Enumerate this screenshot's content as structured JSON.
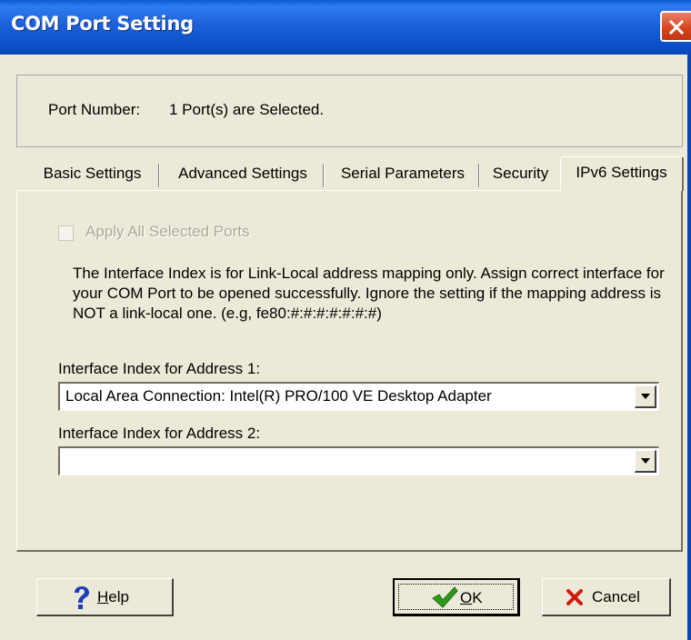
{
  "window": {
    "title": "COM Port Setting"
  },
  "port": {
    "label": "Port Number:",
    "value": "1 Port(s) are Selected."
  },
  "tabs": [
    {
      "label": "Basic Settings"
    },
    {
      "label": "Advanced Settings"
    },
    {
      "label": "Serial Parameters"
    },
    {
      "label": "Security"
    },
    {
      "label": "IPv6 Settings",
      "active": true
    }
  ],
  "apply_all": {
    "label": "Apply All Selected Ports",
    "checked": false,
    "enabled": false
  },
  "description": "The Interface Index is for Link-Local address mapping only. Assign correct interface for your COM Port to be opened successfully. Ignore the setting if the mapping address is NOT a link-local one. (e.g, fe80:#:#:#:#:#:#:#)",
  "address1": {
    "label": "Interface Index for Address 1:",
    "value": "Local Area Connection: Intel(R) PRO/100 VE Desktop Adapter"
  },
  "address2": {
    "label": "Interface Index for Address 2:",
    "value": ""
  },
  "buttons": {
    "help": {
      "mnemonic": "H",
      "rest": "elp"
    },
    "ok": {
      "mnemonic": "O",
      "rest": "K"
    },
    "cancel": {
      "label": "Cancel"
    }
  },
  "icons": {
    "help": "question-mark-icon",
    "ok": "checkmark-icon",
    "cancel": "red-x-icon",
    "close": "close-icon"
  },
  "colors": {
    "titlebar": "#0A5BD6",
    "dialog": "#ECE9D8",
    "close": "#D7451D"
  }
}
